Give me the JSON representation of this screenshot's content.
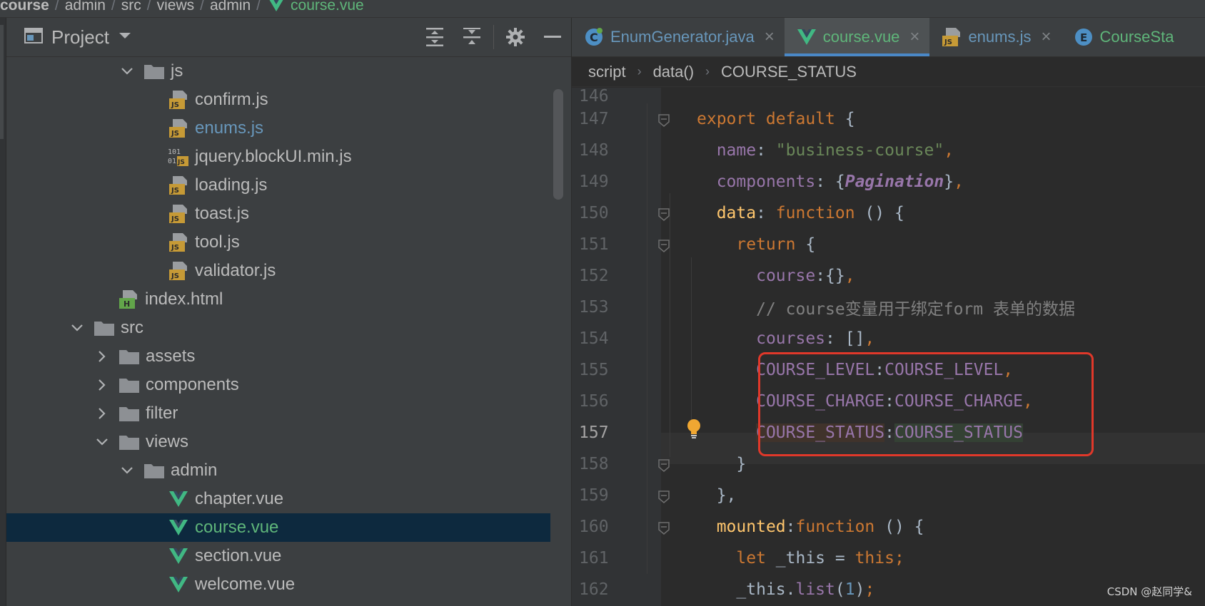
{
  "navbar": {
    "crumbs": [
      "course",
      "admin",
      "src",
      "views",
      "admin"
    ],
    "file": "course.vue"
  },
  "project": {
    "title": "Project",
    "tools": [
      "expand-all-icon",
      "collapse-all-icon",
      "gear-icon",
      "hide-icon"
    ],
    "tree": [
      {
        "label": "js",
        "type": "folder",
        "expanded": true,
        "depth": 4
      },
      {
        "label": "confirm.js",
        "type": "js",
        "depth": 5
      },
      {
        "label": "enums.js",
        "type": "js",
        "depth": 5,
        "modified": true
      },
      {
        "label": "jquery.blockUI.min.js",
        "type": "minjs",
        "depth": 5
      },
      {
        "label": "loading.js",
        "type": "js",
        "depth": 5
      },
      {
        "label": "toast.js",
        "type": "js",
        "depth": 5
      },
      {
        "label": "tool.js",
        "type": "js",
        "depth": 5
      },
      {
        "label": "validator.js",
        "type": "js",
        "depth": 5
      },
      {
        "label": "index.html",
        "type": "html",
        "depth": 3
      },
      {
        "label": "src",
        "type": "folder",
        "expanded": true,
        "depth": 2
      },
      {
        "label": "assets",
        "type": "folder",
        "expanded": false,
        "depth": 3
      },
      {
        "label": "components",
        "type": "folder",
        "expanded": false,
        "depth": 3
      },
      {
        "label": "filter",
        "type": "folder",
        "expanded": false,
        "depth": 3
      },
      {
        "label": "views",
        "type": "folder",
        "expanded": true,
        "depth": 3
      },
      {
        "label": "admin",
        "type": "folder",
        "expanded": true,
        "depth": 4
      },
      {
        "label": "chapter.vue",
        "type": "vue",
        "depth": 5
      },
      {
        "label": "course.vue",
        "type": "vue",
        "depth": 5,
        "selected": true
      },
      {
        "label": "section.vue",
        "type": "vue",
        "depth": 5
      },
      {
        "label": "welcome.vue",
        "type": "vue",
        "depth": 5
      }
    ]
  },
  "tabs": [
    {
      "label": "EnumGenerator.java",
      "type": "java"
    },
    {
      "label": "course.vue",
      "type": "vue",
      "active": true
    },
    {
      "label": "enums.js",
      "type": "js"
    },
    {
      "label": "CourseSta",
      "type": "enum"
    }
  ],
  "code_breadcrumb": [
    "script",
    "data()",
    "COURSE_STATUS"
  ],
  "code": {
    "first_line": 146,
    "partial_top": "146",
    "lines": [
      {
        "n": "147",
        "tokens": [
          [
            "kw",
            "export default"
          ],
          [
            "",
            " {"
          ]
        ]
      },
      {
        "n": "148",
        "tokens": [
          [
            "",
            "  "
          ],
          [
            "prop",
            "name"
          ],
          [
            "",
            ": "
          ],
          [
            "str",
            "\"business-course\""
          ],
          [
            "kw",
            ","
          ]
        ]
      },
      {
        "n": "149",
        "tokens": [
          [
            "",
            "  "
          ],
          [
            "prop",
            "components"
          ],
          [
            "",
            ": {"
          ],
          [
            "it",
            "Pagination"
          ],
          [
            "",
            "}"
          ],
          [
            "kw",
            ","
          ]
        ]
      },
      {
        "n": "150",
        "tokens": [
          [
            "",
            "  "
          ],
          [
            "fn",
            "data"
          ],
          [
            "",
            ": "
          ],
          [
            "kw",
            "function"
          ],
          [
            "",
            " () {"
          ]
        ]
      },
      {
        "n": "151",
        "tokens": [
          [
            "",
            "    "
          ],
          [
            "kw",
            "return"
          ],
          [
            "",
            " {"
          ]
        ]
      },
      {
        "n": "152",
        "tokens": [
          [
            "",
            "      "
          ],
          [
            "prop",
            "course"
          ],
          [
            "",
            ":{}"
          ],
          [
            "kw",
            ","
          ]
        ]
      },
      {
        "n": "153",
        "tokens": [
          [
            "",
            "      "
          ],
          [
            "cm",
            "// course变量用于绑定form 表单的数据"
          ]
        ]
      },
      {
        "n": "154",
        "tokens": [
          [
            "",
            "      "
          ],
          [
            "prop",
            "courses"
          ],
          [
            "",
            ": []"
          ],
          [
            "kw",
            ","
          ]
        ]
      },
      {
        "n": "155",
        "tokens": [
          [
            "",
            "      "
          ],
          [
            "prop",
            "COURSE_LEVEL"
          ],
          [
            "",
            ":"
          ],
          [
            "prop",
            "COURSE_LEVEL"
          ],
          [
            "kw",
            ","
          ]
        ]
      },
      {
        "n": "156",
        "tokens": [
          [
            "",
            "      "
          ],
          [
            "prop",
            "COURSE_CHARGE"
          ],
          [
            "",
            ":"
          ],
          [
            "prop",
            "COURSE_CHARGE"
          ],
          [
            "kw",
            ","
          ]
        ]
      },
      {
        "n": "157",
        "tokens": [
          [
            "",
            "      "
          ],
          [
            "prop hl-read",
            "COURSE_STATUS"
          ],
          [
            "",
            ":"
          ],
          [
            "prop hl-write",
            "COURSE_STATUS"
          ]
        ],
        "current": true
      },
      {
        "n": "158",
        "tokens": [
          [
            "",
            "    }"
          ]
        ]
      },
      {
        "n": "159",
        "tokens": [
          [
            "",
            "  },"
          ]
        ]
      },
      {
        "n": "160",
        "tokens": [
          [
            "",
            "  "
          ],
          [
            "fn",
            "mounted"
          ],
          [
            "",
            ":"
          ],
          [
            "kw",
            "function"
          ],
          [
            "",
            " () {"
          ]
        ]
      },
      {
        "n": "161",
        "tokens": [
          [
            "",
            "    "
          ],
          [
            "kw",
            "let"
          ],
          [
            "",
            " _this = "
          ],
          [
            "kw",
            "this"
          ],
          [
            "kw",
            ";"
          ]
        ]
      },
      {
        "n": "162",
        "tokens": [
          [
            "",
            "    _this."
          ],
          [
            "prop",
            "list"
          ],
          [
            "",
            "("
          ],
          [
            "num",
            "1"
          ],
          [
            "",
            ")"
          ],
          [
            "kw",
            ";"
          ]
        ]
      }
    ]
  },
  "watermark": "CSDN @赵同学&"
}
